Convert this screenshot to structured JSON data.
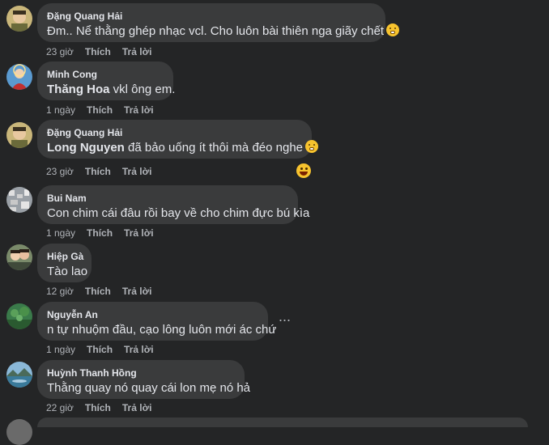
{
  "comments": [
    {
      "author": "Đặng Quang Hải",
      "mention": "",
      "text": "Đm.. Nể thằng ghép nhạc vcl. Cho luôn bài thiên nga giãy chết",
      "time": "23 giờ",
      "like": "Thích",
      "reply": "Trả lời"
    },
    {
      "author": "Minh Cong",
      "mention": "Thăng Hoa",
      "text": " vkl ông em.",
      "time": "1 ngày",
      "like": "Thích",
      "reply": "Trả lời"
    },
    {
      "author": "Đặng Quang Hải",
      "mention": "Long Nguyen",
      "text": " đã bảo uống ít thôi mà đéo nghe",
      "time": "23 giờ",
      "like": "Thích",
      "reply": "Trả lời"
    },
    {
      "author": "Bui Nam",
      "mention": "",
      "text": "Con chim cái đâu rồi bay về cho chim đực bú kìa",
      "time": "1 ngày",
      "like": "Thích",
      "reply": "Trả lời"
    },
    {
      "author": "Hiệp Gà",
      "mention": "",
      "text": "Tào lao",
      "time": "12 giờ",
      "like": "Thích",
      "reply": "Trả lời"
    },
    {
      "author": "Nguyễn An",
      "mention": "",
      "text": "n tự nhuộm đầu, cạo lông luôn mới ác chứ",
      "time": "1 ngày",
      "like": "Thích",
      "reply": "Trả lời"
    },
    {
      "author": "Huỳnh Thanh Hồng",
      "mention": "",
      "text": "Thằng quay nó quay cái lon mẹ nó hả",
      "time": "22 giờ",
      "like": "Thích",
      "reply": "Trả lời"
    }
  ],
  "more_options": "···",
  "colors": {
    "background": "#242526",
    "bubble": "#3a3b3c",
    "text": "#e4e6eb",
    "secondary": "#b0b3b8"
  }
}
